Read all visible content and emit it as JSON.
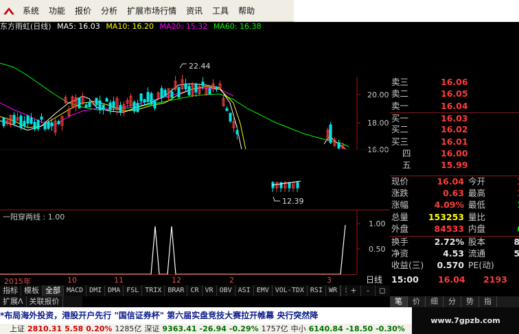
{
  "menu": {
    "items": [
      "系统",
      "功能",
      "报价",
      "分析",
      "扩展市场行情",
      "资讯",
      "工具",
      "帮助"
    ]
  },
  "title": {
    "stock": "东方雨虹(日线)",
    "ma5": "MA5: 16.03",
    "ma10": "MA10: 16.20",
    "ma20": "MA20: 15.32",
    "ma60": "MA60: 16.38"
  },
  "colors": {
    "up": "#ff3c3c",
    "down": "#00e6e6",
    "ma5": "#ffffff",
    "ma10": "#ffff00",
    "ma20": "#ff00ff",
    "ma60": "#00ff00",
    "axis": "#b01010",
    "value_red": "#ff3c3c",
    "value_green": "#00ff00",
    "value_yellow": "#ffff00"
  },
  "chart": {
    "price_ticks": [
      "20.00",
      "18.00",
      "16.00"
    ],
    "high_label": "22.44",
    "low_label": "12.39",
    "indicator_title": "一阳穿两线 : 1.00",
    "indicator_ticks": [
      "1.00",
      "0.50"
    ],
    "x_labels": [
      "2015年",
      "10",
      "11",
      "12",
      "2",
      "3"
    ],
    "period_label": "日线"
  },
  "tabs": [
    "指标",
    "模板",
    "全部",
    "MACD",
    "DMI",
    "DMA",
    "FSL",
    "TRIX",
    "BRAR",
    "CR",
    "VR",
    "OBV",
    "ASI",
    "EMV",
    "VOL-TDX",
    "RSI",
    "WR"
  ],
  "tabs_more": ">",
  "tabs_controls": [
    "+",
    "-",
    "◻"
  ],
  "subtabs": [
    "扩展Λ",
    "关联报价"
  ],
  "quote": {
    "order_book": [
      {
        "label": "卖三",
        "price": "16.06"
      },
      {
        "label": "卖二",
        "price": "16.05"
      },
      {
        "label": "卖一",
        "price": "16.04"
      },
      {
        "label": "买一",
        "price": "16.03"
      },
      {
        "label": "买二",
        "price": "16.02"
      },
      {
        "label": "买三",
        "price": "16.01"
      },
      {
        "label": "四",
        "price": "16.00"
      },
      {
        "label": "五",
        "price": "15.99"
      }
    ],
    "stats": [
      {
        "label": "现价",
        "value": "16.04",
        "label2": "今开",
        "value2": "1"
      },
      {
        "label": "涨跌",
        "value": "0.63",
        "label2": "最高",
        "value2": "1"
      },
      {
        "label": "涨幅",
        "value": "4.09%",
        "label2": "最低",
        "value2": "1"
      },
      {
        "label": "总量",
        "value": "153253",
        "label2": "量比",
        "value2": ""
      },
      {
        "label": "外盘",
        "value": "84533",
        "label2": "内盘",
        "value2": "6"
      },
      {
        "label": "换手",
        "value": "2.72%",
        "label2": "股本",
        "value2": "8."
      },
      {
        "label": "净资",
        "value": "4.53",
        "label2": "流通",
        "value2": "5."
      },
      {
        "label": "收益(三)",
        "value": "0.570",
        "label2": "PE(动)",
        "value2": ""
      }
    ],
    "time": "15:00",
    "last_price": "16.04",
    "last_volume": "2193"
  },
  "side_tabs": [
    "笔",
    "价",
    "细",
    "分",
    "势",
    "指"
  ],
  "marquee": "*布局海外投资，港股开户先行          \"国信证券杯\" 第六届实盘竞技大赛拉开帷幕          央行突然降",
  "index_bar": [
    {
      "text": "上证",
      "color": "#222"
    },
    {
      "text": "2810.31",
      "color": "#d00000"
    },
    {
      "text": "5.58",
      "color": "#d00000"
    },
    {
      "text": "0.20%",
      "color": "#d00000"
    },
    {
      "text": "1285亿",
      "color": "#222"
    },
    {
      "text": "深证",
      "color": "#222"
    },
    {
      "text": "9363.41",
      "color": "#007000"
    },
    {
      "text": "-26.94",
      "color": "#007000"
    },
    {
      "text": "-0.29%",
      "color": "#007000"
    },
    {
      "text": "1757亿",
      "color": "#222"
    },
    {
      "text": "中小",
      "color": "#222"
    },
    {
      "text": "6140.84",
      "color": "#007000"
    },
    {
      "text": "-18.50",
      "color": "#007000"
    },
    {
      "text": "-0.30%",
      "color": "#007000"
    }
  ],
  "watermark": "www.7gpzb.com"
}
